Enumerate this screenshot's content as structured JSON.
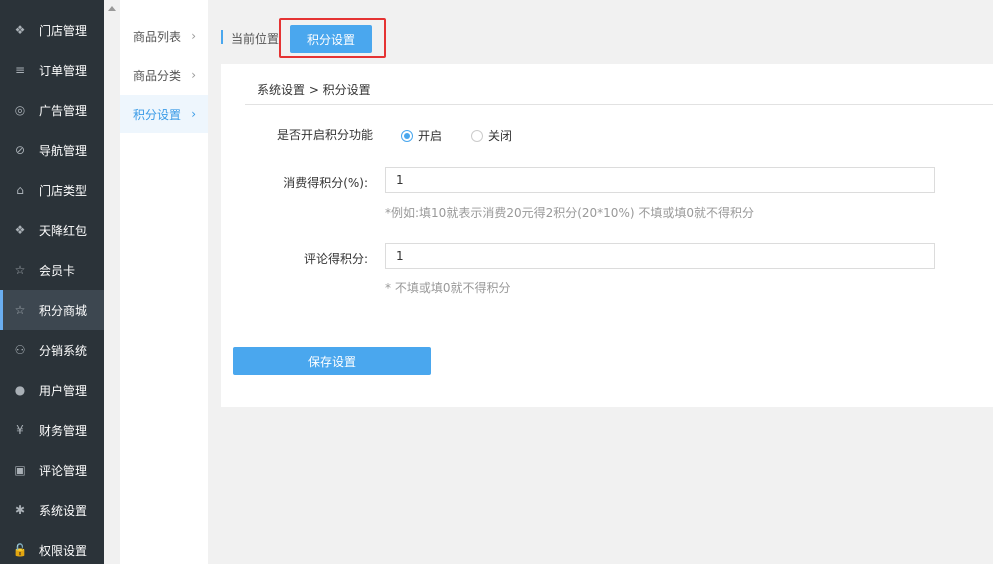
{
  "sidebar": {
    "items": [
      {
        "label": "门店管理",
        "icon": "cluster-icon",
        "glyph": "❖",
        "active": false
      },
      {
        "label": "订单管理",
        "icon": "list-icon",
        "glyph": "≡",
        "active": false
      },
      {
        "label": "广告管理",
        "icon": "lifebuoy-icon",
        "glyph": "◎",
        "active": false
      },
      {
        "label": "导航管理",
        "icon": "compass-icon",
        "glyph": "⊘",
        "active": false
      },
      {
        "label": "门店类型",
        "icon": "bank-icon",
        "glyph": "⌂",
        "active": false
      },
      {
        "label": "天降红包",
        "icon": "cluster-icon",
        "glyph": "❖",
        "active": false
      },
      {
        "label": "会员卡",
        "icon": "star-icon",
        "glyph": "☆",
        "active": false
      },
      {
        "label": "积分商城",
        "icon": "star-icon",
        "glyph": "☆",
        "active": true
      },
      {
        "label": "分销系统",
        "icon": "users-icon",
        "glyph": "⚇",
        "active": false
      },
      {
        "label": "用户管理",
        "icon": "user-icon",
        "glyph": "●",
        "active": false
      },
      {
        "label": "财务管理",
        "icon": "yen-icon",
        "glyph": "¥",
        "active": false
      },
      {
        "label": "评论管理",
        "icon": "money-icon",
        "glyph": "▣",
        "active": false
      },
      {
        "label": "系统设置",
        "icon": "gear-icon",
        "glyph": "✱",
        "active": false
      },
      {
        "label": "权限设置",
        "icon": "unlock-icon",
        "glyph": "🔓",
        "active": false
      }
    ]
  },
  "subnav": {
    "items": [
      {
        "label": "商品列表",
        "active": false
      },
      {
        "label": "商品分类",
        "active": false
      },
      {
        "label": "积分设置",
        "active": true
      }
    ],
    "chevron": "›"
  },
  "header": {
    "location_label": "当前位置",
    "current_button": "积分设置"
  },
  "panel": {
    "breadcrumb": "系统设置 > 积分设置",
    "enable_label": "是否开启积分功能",
    "enable_options": [
      {
        "label": "开启",
        "checked": true
      },
      {
        "label": "关闭",
        "checked": false
      }
    ],
    "consume_label": "消费得积分(%):",
    "consume_value": "1",
    "consume_hint": "*例如:填10就表示消费20元得2积分(20*10%) 不填或填0就不得积分",
    "comment_label": "评论得积分:",
    "comment_value": "1",
    "comment_hint": "* 不填或填0就不得积分",
    "save_label": "保存设置"
  },
  "colors": {
    "accent": "#4aa7ee",
    "sidebar_bg": "#2b3339",
    "highlight_frame": "#e53333"
  }
}
